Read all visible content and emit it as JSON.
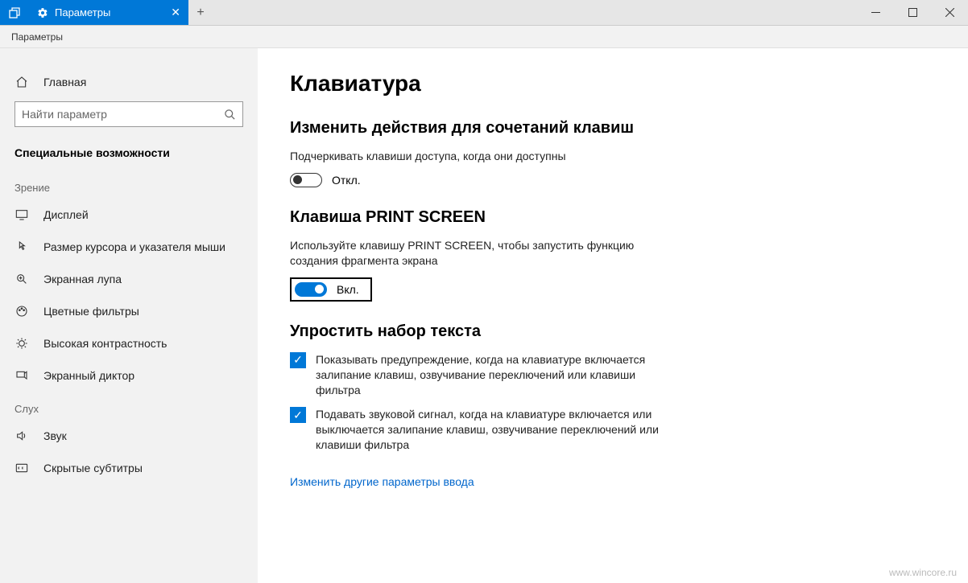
{
  "titlebar": {
    "tab_label": "Параметры",
    "breadcrumb": "Параметры"
  },
  "sidebar": {
    "home_label": "Главная",
    "search_placeholder": "Найти параметр",
    "section_title": "Специальные возможности",
    "group_vision": "Зрение",
    "group_hearing": "Слух",
    "items_vision": [
      "Дисплей",
      "Размер курсора и указателя мыши",
      "Экранная лупа",
      "Цветные фильтры",
      "Высокая контрастность",
      "Экранный диктор"
    ],
    "items_hearing": [
      "Звук",
      "Скрытые субтитры"
    ]
  },
  "main": {
    "title": "Клавиатура",
    "sec1_title": "Изменить действия для сочетаний клавиш",
    "sec1_desc": "Подчеркивать клавиши доступа, когда они доступны",
    "toggle_off_label": "Откл.",
    "sec2_title": "Клавиша PRINT SCREEN",
    "sec2_desc": "Используйте клавишу PRINT SCREEN, чтобы запустить функцию создания фрагмента экрана",
    "toggle_on_label": "Вкл.",
    "sec3_title": "Упростить набор текста",
    "check1": "Показывать предупреждение, когда на клавиатуре включается залипание клавиш, озвучивание переключений или клавиши фильтра",
    "check2": "Подавать звуковой сигнал, когда на клавиатуре включается или выключается залипание клавиш, озвучивание переключений или клавиши фильтра",
    "link": "Изменить другие параметры ввода"
  },
  "watermark": "www.wincore.ru"
}
